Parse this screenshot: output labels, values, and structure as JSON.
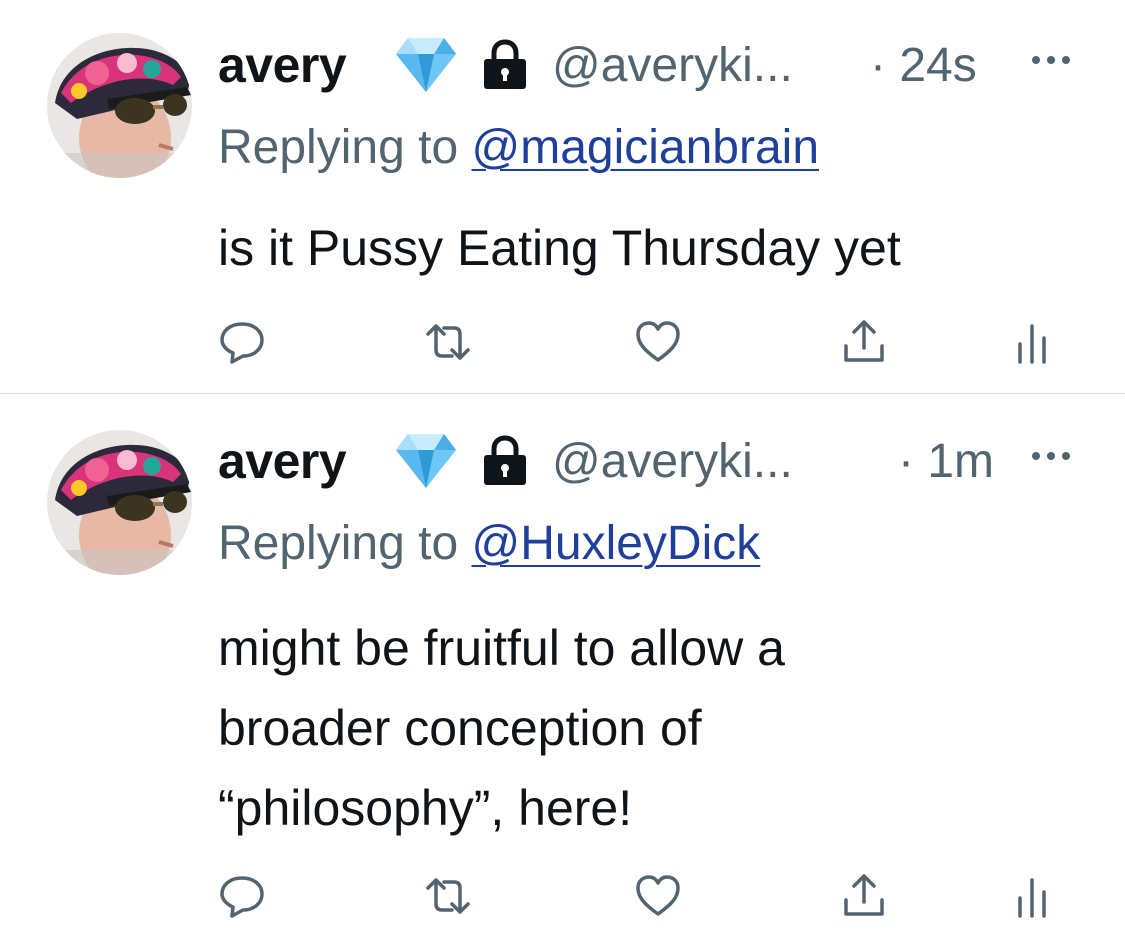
{
  "tweets": [
    {
      "display_name": "avery",
      "verified_icon": "diamond-emoji",
      "protected_icon": "lock-icon",
      "handle": "@averyki...",
      "time": "· 24s",
      "replying_prefix": "Replying to ",
      "replying_to": "@magicianbrain",
      "body_lines": [
        "is it Pussy Eating Thursday yet"
      ]
    },
    {
      "display_name": "avery",
      "verified_icon": "diamond-emoji",
      "protected_icon": "lock-icon",
      "handle": "@averyki...",
      "time": "· 1m",
      "replying_prefix": "Replying to ",
      "replying_to": "@HuxleyDick",
      "body_lines": [
        "might be fruitful to allow a",
        "broader conception of",
        "“philosophy”, here!"
      ]
    }
  ],
  "colors": {
    "text": "#0f1419",
    "secondary": "#536471",
    "link": "#1f3f9a",
    "divider": "#cfd9de"
  }
}
